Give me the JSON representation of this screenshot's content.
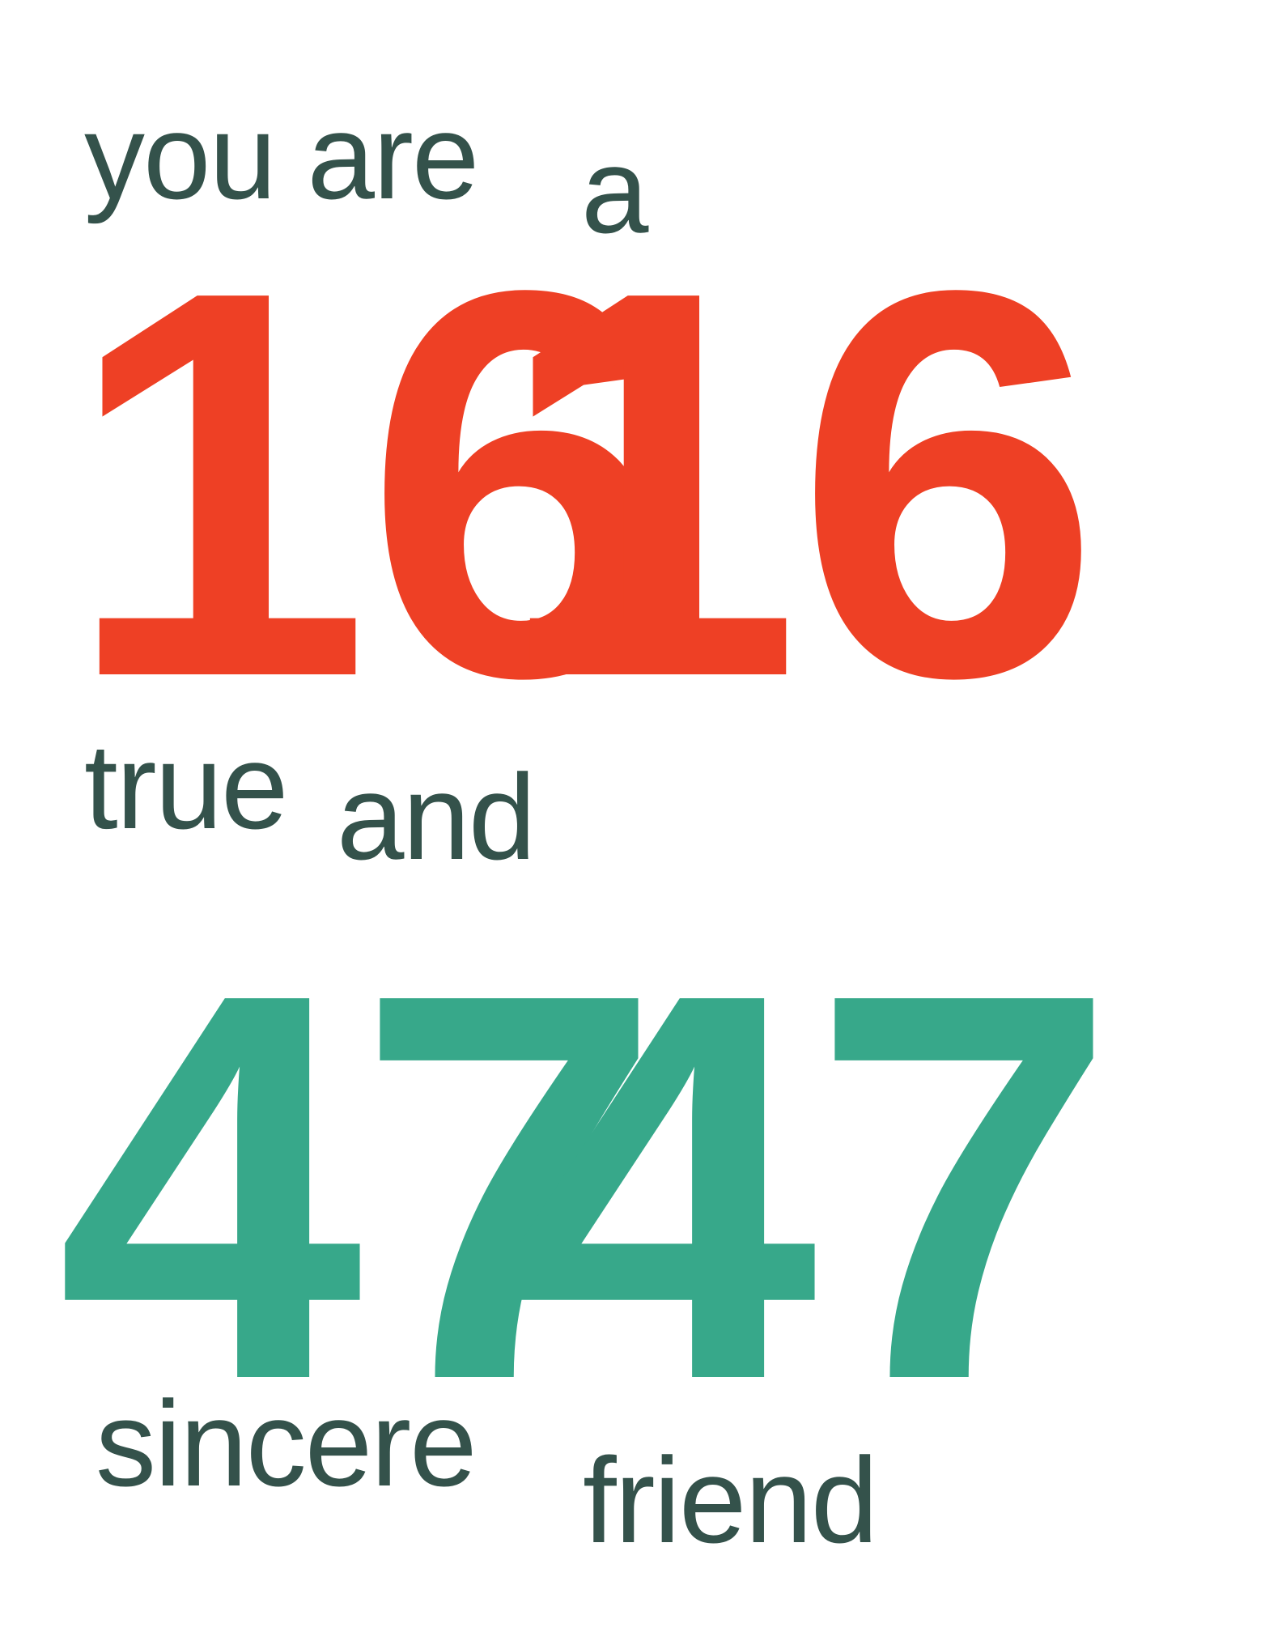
{
  "lines": {
    "you_are": "you are",
    "a_top": "a",
    "number_one_a": "16",
    "number_one_b": "16",
    "true_word": "true",
    "and_word": "and",
    "number_two_a": "47",
    "number_two_b": "47",
    "sincere": "sincere",
    "friend": "friend"
  },
  "colors": {
    "text_dark": "#34524b",
    "number_red": "#ee4025",
    "number_green": "#37a88a",
    "background": "#ffffff"
  }
}
